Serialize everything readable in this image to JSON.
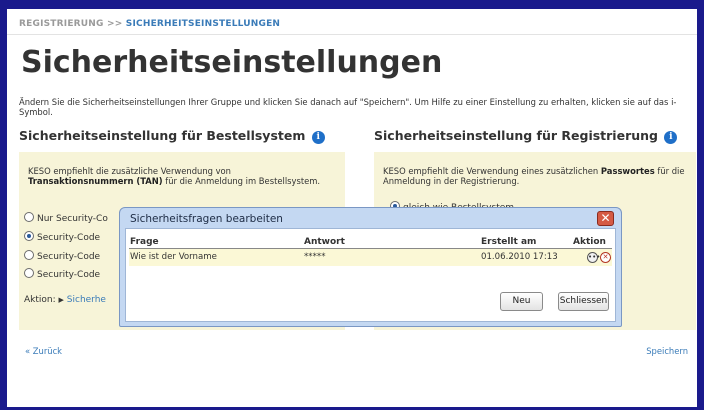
{
  "breadcrumb": {
    "root": "REGISTRIERUNG",
    "separator": ">>",
    "current": "SICHERHEITSEINSTELLUNGEN"
  },
  "page_title": "Sicherheitseinstellungen",
  "intro": "Ändern Sie die Sicherheitseinstellungen Ihrer Gruppe und klicken Sie danach auf \"Speichern\". Um Hilfe zu einer Einstellung zu erhalten, klicken sie auf das i-Symbol.",
  "left_section": {
    "title": "Sicherheitseinstellung für Bestellsystem",
    "text_before": "KESO empfiehlt die zusätzliche Verwendung von ",
    "text_bold": "Transaktionsnummern (TAN)",
    "text_after": " für die Anmeldung im Bestellsystem.",
    "options": [
      "Nur Security-Co",
      "Security-Code",
      "Security-Code",
      "Security-Code"
    ],
    "selected_index": 1,
    "action_label": "Aktion:",
    "action_link": "Sicherhe"
  },
  "right_section": {
    "title": "Sicherheitseinstellung für Registrierung",
    "text_before": "KESO empfiehlt die Verwendung eines zusätzlichen ",
    "text_bold": "Passwortes",
    "text_after": " für die Anmeldung in der Registrierung.",
    "option": "gleich wie Bestellsystem"
  },
  "footer": {
    "back": "« Zurück",
    "save": "Speichern"
  },
  "dialog": {
    "title": "Sicherheitsfragen bearbeiten",
    "columns": {
      "question": "Frage",
      "answer": "Antwort",
      "created": "Erstellt am",
      "action": "Aktion"
    },
    "rows": [
      {
        "question": "Wie ist der Vorname",
        "answer": "*****",
        "created": "01.06.2010 17:13"
      }
    ],
    "new_button": "Neu",
    "close_button": "Schliessen"
  }
}
